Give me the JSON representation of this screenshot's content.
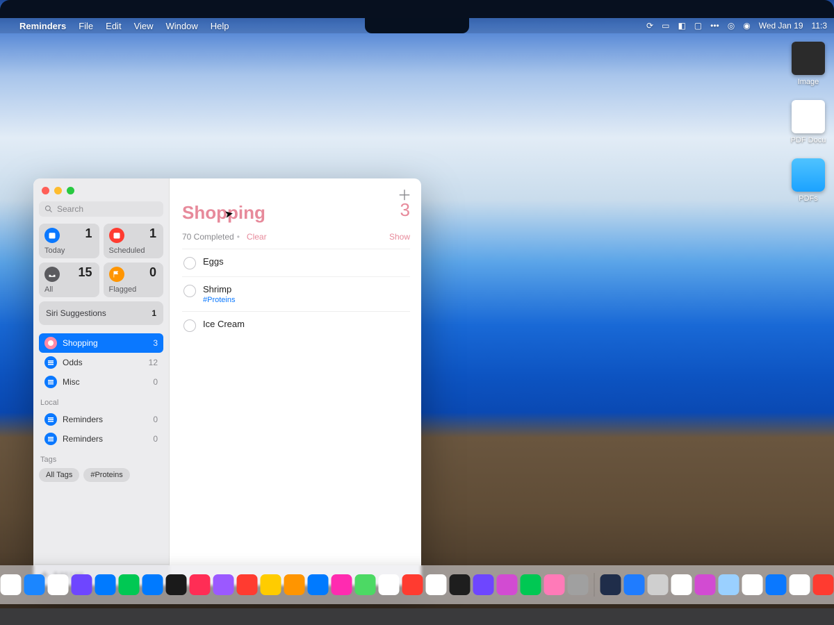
{
  "menubar": {
    "app": "Reminders",
    "items": [
      "File",
      "Edit",
      "View",
      "Window",
      "Help"
    ],
    "date": "Wed Jan 19",
    "time": "11:3"
  },
  "desktop": {
    "icons": [
      {
        "label": "Image"
      },
      {
        "label": "PDF Docu"
      },
      {
        "label": "PDFs"
      }
    ]
  },
  "sidebar": {
    "search_placeholder": "Search",
    "cards": [
      {
        "name": "today",
        "label": "Today",
        "count": 1,
        "color": "blue"
      },
      {
        "name": "scheduled",
        "label": "Scheduled",
        "count": 1,
        "color": "red"
      },
      {
        "name": "all",
        "label": "All",
        "count": 15,
        "color": "grey"
      },
      {
        "name": "flagged",
        "label": "Flagged",
        "count": 0,
        "color": "orange"
      }
    ],
    "siri": {
      "label": "Siri Suggestions",
      "count": 1
    },
    "lists": [
      {
        "id": "shopping",
        "label": "Shopping",
        "count": 3,
        "active": true,
        "badge": "pinkish"
      },
      {
        "id": "odds",
        "label": "Odds",
        "count": 12,
        "active": false,
        "badge": "blue"
      },
      {
        "id": "misc",
        "label": "Misc",
        "count": 0,
        "active": false,
        "badge": "blue"
      }
    ],
    "local_label": "Local",
    "local_lists": [
      {
        "id": "reminders1",
        "label": "Reminders",
        "count": 0
      },
      {
        "id": "reminders2",
        "label": "Reminders",
        "count": 0
      }
    ],
    "tags_label": "Tags",
    "tags": [
      "All Tags",
      "#Proteins"
    ],
    "add_list": "Add List"
  },
  "pane": {
    "title": "Shopping",
    "count": 3,
    "completed_text": "70 Completed",
    "clear": "Clear",
    "show": "Show",
    "items": [
      {
        "text": "Eggs",
        "sub": ""
      },
      {
        "text": "Shrimp",
        "sub": "#Proteins"
      },
      {
        "text": "Ice Cream",
        "sub": ""
      }
    ]
  },
  "dock": {
    "apps": [
      "#1f7cff",
      "#e6e6e6",
      "#d24bd2",
      "#34c759",
      "#00b7ff",
      "#ffffff",
      "#1b86ff",
      "#ffffff",
      "#6e46ff",
      "#007aff",
      "#00c853",
      "#007aff",
      "#1a1a1a",
      "#ff2d55",
      "#9b59ff",
      "#ff3b30",
      "#ffcc00",
      "#ff9500",
      "#007aff",
      "#ff2bb0",
      "#4cd964",
      "#ffffff",
      "#ff3b30",
      "#ffffff",
      "#1e1e1e",
      "#6e46ff",
      "#d24bd2",
      "#00c853",
      "#ff7ab8",
      "#a0a0a0",
      "#1f2d4a",
      "#1f7cff",
      "#cfcfcf",
      "#ffffff",
      "#d24bd2",
      "#9ad0ff",
      "#ffffff",
      "#0a78ff",
      "#ffffff",
      "#ff3b30",
      "#d0d0d0",
      "#1a1a1a",
      "#b9a9ff",
      "#8a8a8e",
      "#8a8a8e"
    ]
  }
}
